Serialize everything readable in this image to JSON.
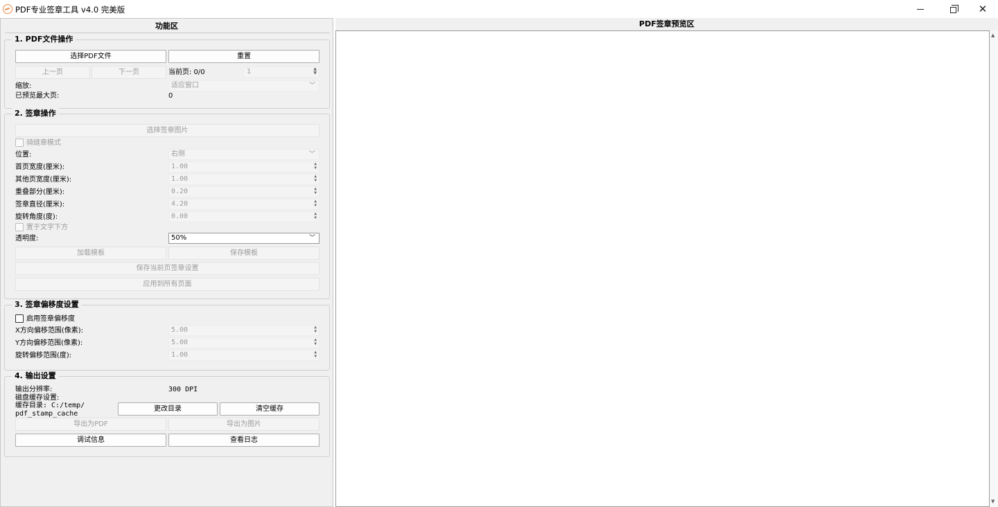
{
  "window": {
    "title": "PDF专业签章工具 v4.0 完美版",
    "controls": {
      "minimize": "—",
      "maximize": "□",
      "close": "✕"
    }
  },
  "left_panel": {
    "header": "功能区",
    "file_ops": {
      "title": "1. PDF文件操作",
      "select_pdf": "选择PDF文件",
      "reset": "重置",
      "prev_page": "上一页",
      "next_page": "下一页",
      "current_page_label": "当前页: 0/0",
      "page_spin_value": "1",
      "zoom_label": "缩放:",
      "zoom_value": "适应窗口",
      "max_preview_label": "已预览最大页:",
      "max_preview_value": "0"
    },
    "stamp_ops": {
      "title": "2. 签章操作",
      "select_stamp_image": "选择签章图片",
      "seam_mode_label": "骑缝章模式",
      "seam_mode_checked": false,
      "position_label": "位置:",
      "position_value": "右侧",
      "first_width_label": "首页宽度(厘米):",
      "first_width_value": "1.00",
      "other_width_label": "其他页宽度(厘米):",
      "other_width_value": "1.00",
      "overlap_label": "重叠部分(厘米):",
      "overlap_value": "0.20",
      "diameter_label": "签章直径(厘米):",
      "diameter_value": "4.20",
      "rotation_label": "旋转角度(度):",
      "rotation_value": "0.00",
      "below_text_label": "置于文字下方",
      "below_text_checked": false,
      "opacity_label": "透明度:",
      "opacity_value": "50%",
      "load_template": "加载模板",
      "save_template": "保存模板",
      "save_current": "保存当前页签章设置",
      "apply_all": "应用到所有页面"
    },
    "offset": {
      "title": "3. 签章偏移度设置",
      "enable_label": "启用签章偏移度",
      "enable_checked": false,
      "x_label": "X方向偏移范围(像素):",
      "x_value": "5.00",
      "y_label": "Y方向偏移范围(像素):",
      "y_value": "5.00",
      "rot_label": "旋转偏移范围(度):",
      "rot_value": "1.00"
    },
    "output": {
      "title": "4. 输出设置",
      "dpi_label": "输出分辨率:",
      "dpi_value": "300 DPI",
      "disk_cache_label": "磁盘缓存设置:",
      "cache_dir_line1": "缓存目录: C:/temp/",
      "cache_dir_line2": "pdf_stamp_cache",
      "change_dir": "更改目录",
      "clear_cache": "清空缓存",
      "export_pdf": "导出为PDF",
      "export_image": "导出为图片",
      "debug_info": "调试信息",
      "view_log": "查看日志"
    }
  },
  "right_panel": {
    "header": "PDF签章预览区"
  },
  "colors": {
    "panel_bg": "#f0f0f0",
    "disabled_text": "#9b9b9b",
    "canvas_bg": "#ffffff"
  }
}
